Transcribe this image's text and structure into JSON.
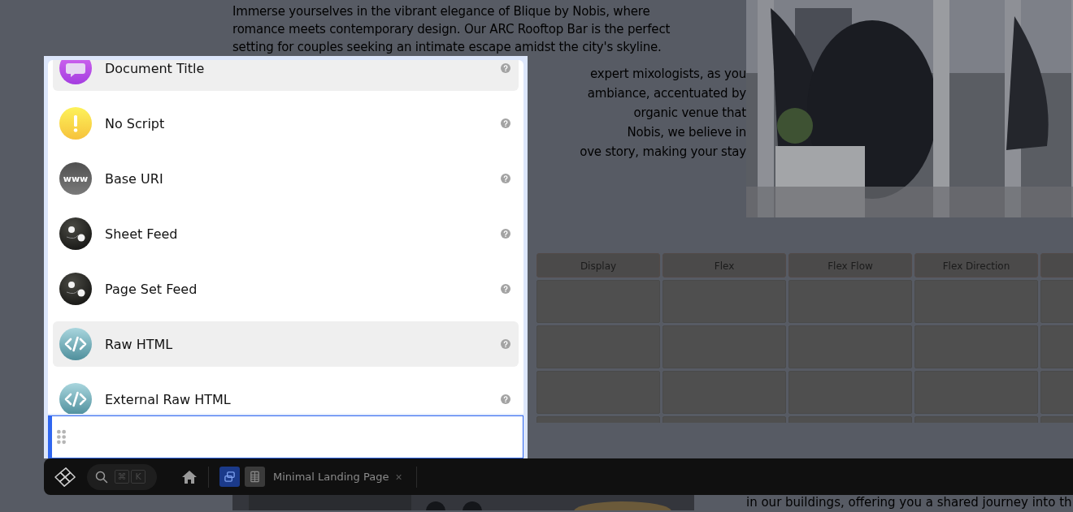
{
  "page": {
    "paragraph_lines": [
      "Immerse yourselves in the vibrant elegance of Blique by Nobis, where",
      "romance meets contemporary design. Our ARC Rooftop Bar is the perfect",
      "setting for couples seeking an intimate escape amidst the city's skyline."
    ],
    "paragraph_fragments": [
      "expert mixologists, as you",
      "ambiance, accentuated by",
      "organic venue that",
      "Nobis, we believe in",
      "ove story, making your stay"
    ],
    "photo": {
      "kind": "picture"
    },
    "table": {
      "columns": [
        "Display",
        "Flex",
        "Flex Flow",
        "Flex Direction",
        ""
      ]
    },
    "bottom_picture": {
      "kind": "picture"
    },
    "bottom_text": "in our buildings, offering you a shared journey into th"
  },
  "panel": {
    "items": [
      {
        "label": "Document Title",
        "kind": "message",
        "selected": true
      },
      {
        "label": "No Script",
        "kind": "warning",
        "selected": false
      },
      {
        "label": "Base URI",
        "kind": "web",
        "icon_text": "www",
        "selected": false
      },
      {
        "label": "Sheet Feed",
        "kind": "feed",
        "selected": false
      },
      {
        "label": "Page Set Feed",
        "kind": "feed",
        "selected": false
      },
      {
        "label": "Raw HTML",
        "kind": "code",
        "selected": true
      },
      {
        "label": "External Raw HTML",
        "kind": "code",
        "selected": false
      }
    ],
    "drop_block": {
      "active": true
    }
  },
  "toolbar": {
    "shortcut_keys": [
      "⌘",
      "K"
    ],
    "tabs": [
      {
        "kind": "pages",
        "selected": true
      },
      {
        "kind": "table",
        "selected": false
      }
    ],
    "document_title": "Minimal Landing Page",
    "close": "×"
  }
}
